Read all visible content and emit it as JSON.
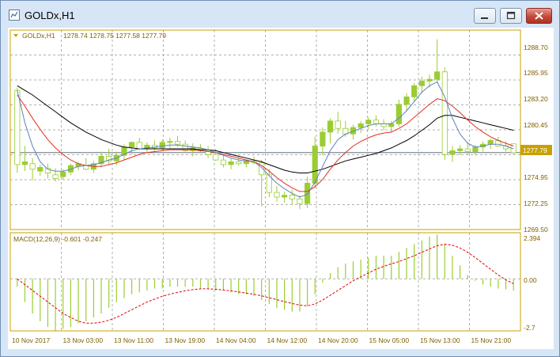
{
  "window": {
    "title": "GOLDx,H1",
    "buttons": {
      "minimize": "minimize",
      "maximize": "maximize",
      "close": "close"
    }
  },
  "legend": {
    "symbol": "GOLDx,H1",
    "ohlc": "1278.74 1278.75 1277.58 1277.79"
  },
  "macd_legend": "MACD(12,26,9) -0.601 -0.247",
  "price_axis": {
    "labels": [
      "1288.70",
      "1285.95",
      "1283.20",
      "1280.45",
      "1274.95",
      "1272.25",
      "1269.50"
    ],
    "current": "1277.79"
  },
  "macd_axis": {
    "labels": [
      "2.394",
      "0.00",
      "-2.7"
    ]
  },
  "time_axis": [
    "10 Nov 2017",
    "13 Nov 03:00",
    "13 Nov 11:00",
    "13 Nov 19:00",
    "14 Nov 04:00",
    "14 Nov 12:00",
    "14 Nov 20:00",
    "15 Nov 05:00",
    "15 Nov 13:00",
    "15 Nov 21:00"
  ],
  "colors": {
    "candle": "#9acd32",
    "frame": "#c8a000",
    "grid": "#b0b0b0",
    "ma_fast": "#6080c0",
    "ma_mid": "#e03020",
    "ma_slow": "#000000",
    "signal": "#e00000",
    "bid": "#4a5a6a"
  },
  "chart_data": {
    "type": "candlestick",
    "price_range": [
      1269.5,
      1291.0
    ],
    "macd_range": [
      -2.7,
      2.394
    ],
    "candles": [
      [
        1284.5,
        1284.8,
        1275.6,
        1276.5
      ],
      [
        1276.5,
        1278.5,
        1275.8,
        1276.8
      ],
      [
        1276.6,
        1277.2,
        1274.8,
        1276.0
      ],
      [
        1275.8,
        1276.5,
        1275.3,
        1276.2
      ],
      [
        1276.1,
        1276.6,
        1275.0,
        1275.6
      ],
      [
        1275.4,
        1276.1,
        1274.7,
        1275.0
      ],
      [
        1275.2,
        1276.0,
        1274.9,
        1275.7
      ],
      [
        1275.7,
        1276.6,
        1275.4,
        1276.4
      ],
      [
        1276.3,
        1276.8,
        1275.9,
        1276.6
      ],
      [
        1276.4,
        1277.2,
        1275.9,
        1276.0
      ],
      [
        1276.0,
        1276.9,
        1275.6,
        1276.6
      ],
      [
        1276.6,
        1277.9,
        1276.2,
        1277.4
      ],
      [
        1277.4,
        1278.2,
        1276.5,
        1276.9
      ],
      [
        1276.9,
        1277.9,
        1276.4,
        1277.5
      ],
      [
        1277.5,
        1278.7,
        1277.0,
        1278.4
      ],
      [
        1278.4,
        1279.0,
        1277.6,
        1278.9
      ],
      [
        1278.9,
        1279.4,
        1278.0,
        1278.2
      ],
      [
        1278.3,
        1278.9,
        1277.7,
        1278.6
      ],
      [
        1278.6,
        1279.1,
        1278.0,
        1278.3
      ],
      [
        1278.3,
        1279.2,
        1278.0,
        1278.9
      ],
      [
        1278.9,
        1279.4,
        1278.3,
        1279.0
      ],
      [
        1279.0,
        1279.6,
        1278.4,
        1278.7
      ],
      [
        1278.7,
        1279.1,
        1277.9,
        1278.0
      ],
      [
        1278.0,
        1278.8,
        1277.4,
        1278.3
      ],
      [
        1278.2,
        1278.7,
        1277.8,
        1278.0
      ],
      [
        1278.0,
        1278.5,
        1277.2,
        1277.6
      ],
      [
        1277.6,
        1278.2,
        1276.9,
        1277.0
      ],
      [
        1277.0,
        1277.6,
        1276.2,
        1276.5
      ],
      [
        1276.5,
        1277.2,
        1276.0,
        1276.8
      ],
      [
        1276.8,
        1277.3,
        1276.4,
        1276.6
      ],
      [
        1276.6,
        1277.0,
        1276.2,
        1276.9
      ],
      [
        1276.9,
        1277.4,
        1276.5,
        1276.7
      ],
      [
        1276.7,
        1277.0,
        1272.0,
        1275.4
      ],
      [
        1275.4,
        1276.0,
        1273.0,
        1273.5
      ],
      [
        1273.5,
        1274.2,
        1272.5,
        1273.0
      ],
      [
        1273.0,
        1273.6,
        1272.4,
        1273.2
      ],
      [
        1273.2,
        1273.8,
        1272.2,
        1272.8
      ],
      [
        1272.8,
        1273.2,
        1271.7,
        1272.3
      ],
      [
        1272.3,
        1275.2,
        1271.8,
        1274.5
      ],
      [
        1274.5,
        1279.5,
        1274.0,
        1278.5
      ],
      [
        1278.5,
        1280.5,
        1277.5,
        1280.0
      ],
      [
        1280.0,
        1281.5,
        1278.8,
        1281.2
      ],
      [
        1281.2,
        1282.2,
        1279.8,
        1280.4
      ],
      [
        1280.4,
        1281.2,
        1279.5,
        1279.8
      ],
      [
        1279.8,
        1280.8,
        1279.2,
        1280.5
      ],
      [
        1280.5,
        1281.2,
        1279.9,
        1280.9
      ],
      [
        1280.9,
        1281.6,
        1280.3,
        1281.3
      ],
      [
        1281.3,
        1281.8,
        1280.6,
        1280.9
      ],
      [
        1280.9,
        1281.4,
        1280.2,
        1280.6
      ],
      [
        1280.6,
        1281.2,
        1280.0,
        1280.9
      ],
      [
        1280.9,
        1283.5,
        1280.6,
        1283.0
      ],
      [
        1283.0,
        1284.2,
        1282.3,
        1283.8
      ],
      [
        1283.8,
        1285.3,
        1283.3,
        1285.0
      ],
      [
        1285.0,
        1286.0,
        1284.2,
        1285.5
      ],
      [
        1285.5,
        1286.2,
        1284.8,
        1285.7
      ],
      [
        1285.7,
        1290.0,
        1285.3,
        1286.5
      ],
      [
        1286.5,
        1287.0,
        1277.0,
        1277.6
      ],
      [
        1277.6,
        1278.5,
        1276.8,
        1278.0
      ],
      [
        1278.0,
        1278.6,
        1277.5,
        1278.2
      ],
      [
        1278.2,
        1278.9,
        1277.6,
        1277.9
      ],
      [
        1277.9,
        1278.6,
        1277.5,
        1278.4
      ],
      [
        1278.4,
        1279.0,
        1277.9,
        1278.7
      ],
      [
        1278.7,
        1279.3,
        1278.2,
        1279.1
      ],
      [
        1279.1,
        1279.5,
        1278.4,
        1278.5
      ],
      [
        1278.5,
        1279.0,
        1277.9,
        1278.2
      ],
      [
        1278.74,
        1278.75,
        1277.58,
        1277.79
      ]
    ],
    "ma_fast": [
      1284.5,
      1281.0,
      1278.5,
      1276.8,
      1276.0,
      1275.8,
      1275.8,
      1276.0,
      1276.3,
      1276.4,
      1276.5,
      1276.7,
      1277.0,
      1277.2,
      1277.6,
      1278.0,
      1278.2,
      1278.3,
      1278.4,
      1278.5,
      1278.6,
      1278.6,
      1278.5,
      1278.4,
      1278.3,
      1278.1,
      1277.8,
      1277.5,
      1277.2,
      1277.0,
      1276.9,
      1276.8,
      1276.2,
      1275.3,
      1274.5,
      1273.9,
      1273.4,
      1273.0,
      1273.3,
      1274.6,
      1276.3,
      1278.0,
      1279.2,
      1279.8,
      1280.1,
      1280.4,
      1280.7,
      1280.9,
      1280.9,
      1280.9,
      1281.5,
      1282.3,
      1283.3,
      1284.3,
      1285.0,
      1285.4,
      1283.8,
      1281.5,
      1279.8,
      1278.8,
      1278.4,
      1278.5,
      1278.7,
      1278.7,
      1278.5,
      1278.2
    ],
    "ma_mid": [
      1284.0,
      1282.8,
      1281.5,
      1280.3,
      1279.2,
      1278.3,
      1277.6,
      1277.0,
      1276.6,
      1276.4,
      1276.3,
      1276.3,
      1276.5,
      1276.7,
      1277.0,
      1277.3,
      1277.6,
      1277.8,
      1277.9,
      1278.0,
      1278.1,
      1278.1,
      1278.1,
      1278.1,
      1278.0,
      1277.9,
      1277.8,
      1277.6,
      1277.4,
      1277.2,
      1277.0,
      1276.8,
      1276.4,
      1275.8,
      1275.1,
      1274.5,
      1274.0,
      1273.6,
      1273.6,
      1274.1,
      1274.9,
      1276.0,
      1277.0,
      1277.8,
      1278.5,
      1279.0,
      1279.4,
      1279.7,
      1279.9,
      1280.0,
      1280.4,
      1280.9,
      1281.6,
      1282.3,
      1283.0,
      1283.6,
      1283.4,
      1282.8,
      1282.1,
      1281.3,
      1280.6,
      1280.0,
      1279.5,
      1279.1,
      1278.8,
      1278.5
    ],
    "ma_slow": [
      1285.0,
      1284.5,
      1284.0,
      1283.4,
      1282.8,
      1282.2,
      1281.6,
      1281.0,
      1280.5,
      1280.0,
      1279.6,
      1279.2,
      1278.9,
      1278.6,
      1278.4,
      1278.3,
      1278.2,
      1278.2,
      1278.2,
      1278.2,
      1278.2,
      1278.2,
      1278.2,
      1278.2,
      1278.1,
      1278.1,
      1278.0,
      1277.8,
      1277.6,
      1277.4,
      1277.2,
      1277.0,
      1276.8,
      1276.5,
      1276.2,
      1275.9,
      1275.7,
      1275.6,
      1275.6,
      1275.8,
      1276.0,
      1276.3,
      1276.6,
      1276.9,
      1277.1,
      1277.3,
      1277.5,
      1277.7,
      1278.0,
      1278.3,
      1278.7,
      1279.1,
      1279.6,
      1280.2,
      1280.8,
      1281.5,
      1281.8,
      1281.8,
      1281.6,
      1281.4,
      1281.2,
      1281.0,
      1280.8,
      1280.6,
      1280.4,
      1280.2
    ],
    "macd_hist": [
      -0.4,
      -1.2,
      -1.8,
      -2.2,
      -2.5,
      -2.7,
      -2.6,
      -2.5,
      -2.3,
      -2.2,
      -2.0,
      -1.8,
      -1.5,
      -1.2,
      -1.0,
      -0.8,
      -0.7,
      -0.6,
      -0.5,
      -0.5,
      -0.4,
      -0.4,
      -0.4,
      -0.4,
      -0.5,
      -0.5,
      -0.6,
      -0.6,
      -0.7,
      -0.8,
      -0.8,
      -0.9,
      -1.1,
      -1.3,
      -1.5,
      -1.6,
      -1.7,
      -1.7,
      -1.4,
      -0.8,
      -0.2,
      0.3,
      0.6,
      0.8,
      0.9,
      1.0,
      1.1,
      1.2,
      1.2,
      1.2,
      1.4,
      1.6,
      1.8,
      2.0,
      2.2,
      2.3,
      1.8,
      1.2,
      0.7,
      0.2,
      -0.1,
      -0.3,
      -0.4,
      -0.5,
      -0.55,
      -0.601
    ],
    "macd_signal": [
      0.0,
      -0.3,
      -0.6,
      -0.9,
      -1.2,
      -1.5,
      -1.8,
      -2.0,
      -2.2,
      -2.3,
      -2.3,
      -2.25,
      -2.15,
      -2.0,
      -1.8,
      -1.6,
      -1.4,
      -1.2,
      -1.05,
      -0.9,
      -0.8,
      -0.7,
      -0.62,
      -0.56,
      -0.52,
      -0.52,
      -0.54,
      -0.58,
      -0.62,
      -0.68,
      -0.74,
      -0.8,
      -0.88,
      -0.98,
      -1.08,
      -1.18,
      -1.28,
      -1.36,
      -1.4,
      -1.3,
      -1.1,
      -0.85,
      -0.6,
      -0.35,
      -0.1,
      0.1,
      0.3,
      0.5,
      0.65,
      0.78,
      0.9,
      1.05,
      1.2,
      1.38,
      1.55,
      1.72,
      1.8,
      1.75,
      1.6,
      1.38,
      1.1,
      0.8,
      0.5,
      0.2,
      -0.05,
      -0.247
    ]
  }
}
